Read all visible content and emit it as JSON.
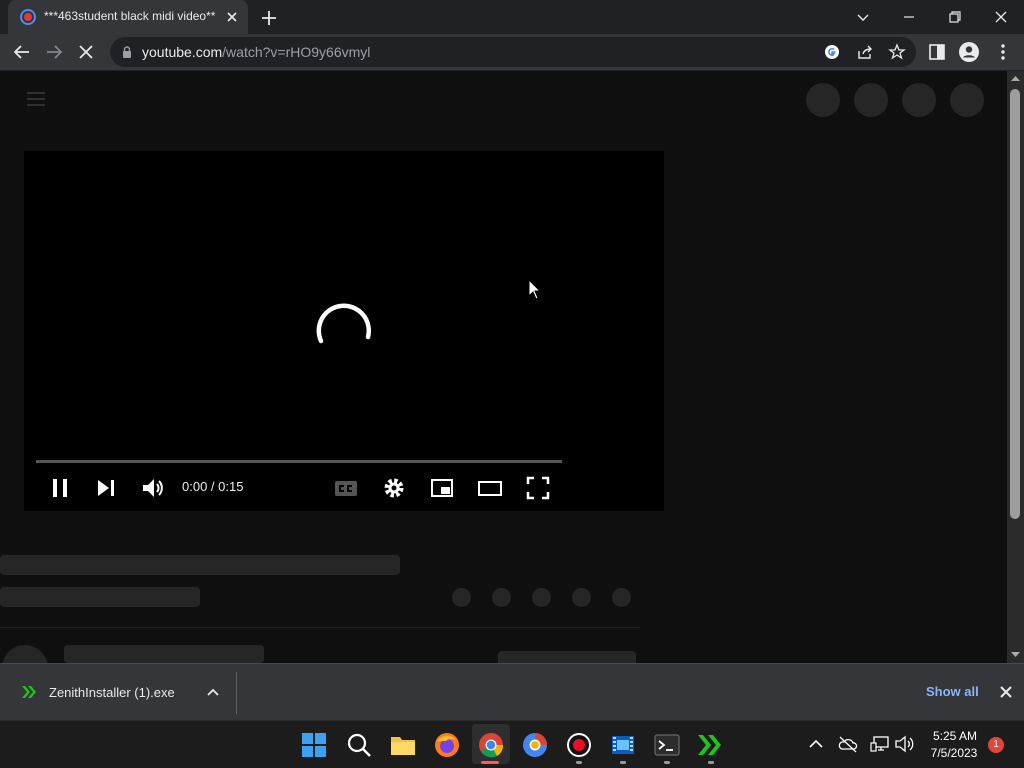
{
  "browser": {
    "tab": {
      "title": "***463student black midi video**"
    },
    "url": {
      "host": "youtube.com",
      "path": "/watch?v=rHO9y66vmyl"
    },
    "icons": [
      "back-icon",
      "forward-icon",
      "stop-loading-icon",
      "lock-icon",
      "google-lens-icon",
      "share-icon",
      "bookmark-star-icon",
      "side-panel-icon",
      "profile-icon",
      "menu-dots-icon"
    ]
  },
  "player": {
    "time": "0:00 / 0:15",
    "progress_fraction": 0.0,
    "state": "loading"
  },
  "downloads": {
    "file_name": "ZenithInstaller (1).exe",
    "show_all": "Show all"
  },
  "taskbar": {
    "time": "5:25 AM",
    "date": "7/5/2023",
    "notification_count": "1"
  },
  "colors": {
    "accent_red": "#ff0000",
    "link_blue": "#8ab4f8",
    "download_green": "#1ec31e"
  }
}
